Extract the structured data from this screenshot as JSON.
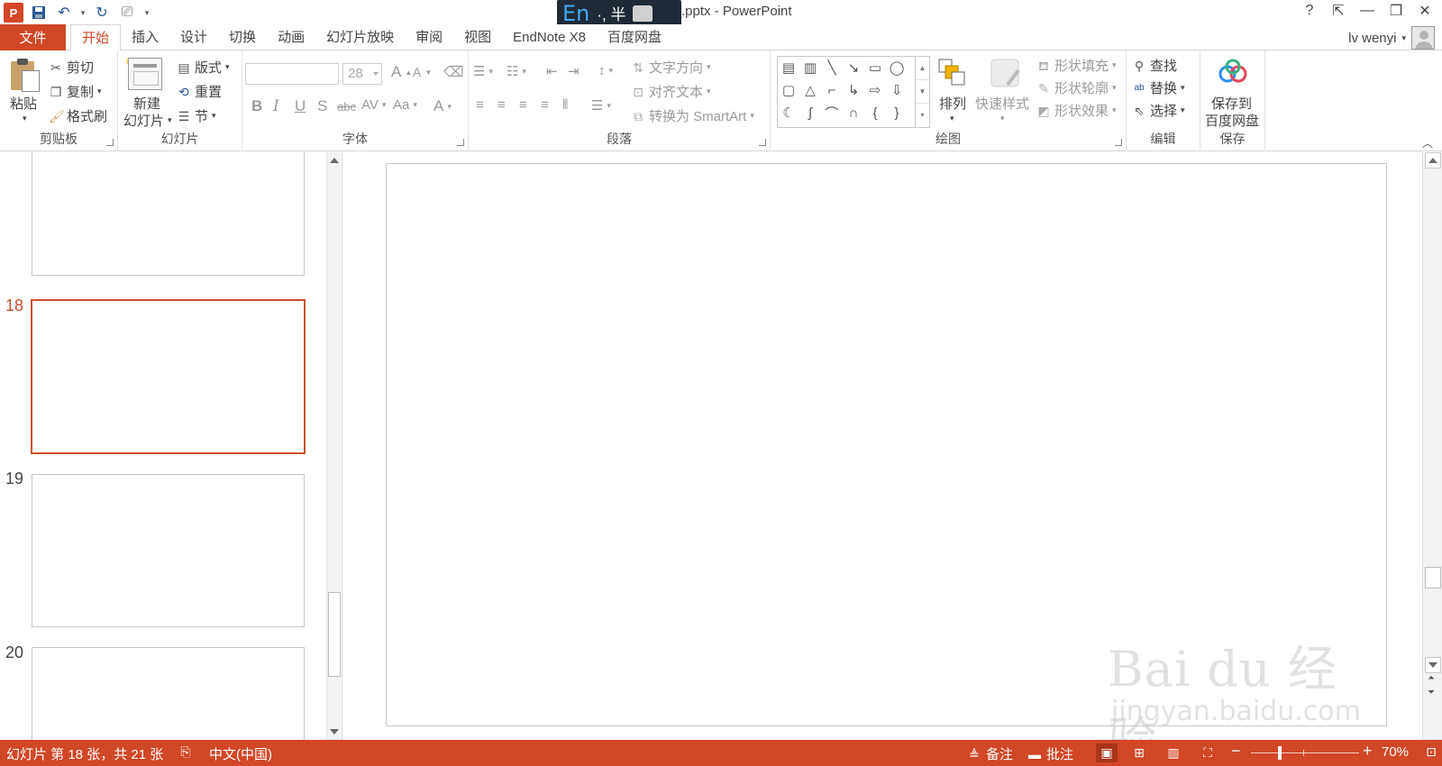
{
  "window": {
    "title": ".pptx - PowerPoint",
    "ime": {
      "lang": "En",
      "punct": "·, 半"
    },
    "controls": [
      "?",
      "⇱",
      "—",
      "❐",
      "✕"
    ]
  },
  "qat": {
    "app_icon": "P",
    "icons": [
      "save-icon",
      "undo-icon",
      "redo-icon",
      "present-from-start-icon",
      "customize-qat-icon"
    ]
  },
  "tabs": {
    "file": "文件",
    "items": [
      "开始",
      "插入",
      "设计",
      "切换",
      "动画",
      "幻灯片放映",
      "审阅",
      "视图",
      "EndNote X8",
      "百度网盘"
    ],
    "active_index": 0
  },
  "user": {
    "name": "lv wenyi"
  },
  "ribbon": {
    "clipboard": {
      "label": "剪贴板",
      "paste": "粘贴",
      "cut": "剪切",
      "copy": "复制",
      "format_painter": "格式刷"
    },
    "slides": {
      "label": "幻灯片",
      "new_slide_1": "新建",
      "new_slide_2": "幻灯片",
      "layout": "版式",
      "reset": "重置",
      "section": "节"
    },
    "font": {
      "label": "字体",
      "font_name": "",
      "font_size": "28"
    },
    "paragraph": {
      "label": "段落",
      "text_direction": "文字方向",
      "align_text": "对齐文本",
      "smartart": "转换为 SmartArt"
    },
    "drawing": {
      "label": "绘图",
      "arrange": "排列",
      "quick_styles": "快速样式",
      "shape_fill": "形状填充",
      "shape_outline": "形状轮廓",
      "shape_effects": "形状效果"
    },
    "editing": {
      "label": "编辑",
      "find": "查找",
      "replace": "替换",
      "select": "选择"
    },
    "save": {
      "label": "保存",
      "save_to_1": "保存到",
      "save_to_2": "百度网盘"
    }
  },
  "thumbnails": [
    {
      "number": "",
      "selected": false
    },
    {
      "number": "18",
      "selected": true
    },
    {
      "number": "19",
      "selected": false
    },
    {
      "number": "20",
      "selected": false
    }
  ],
  "status": {
    "slide_info": "幻灯片 第 18 张，共 21 张",
    "language": "中文(中国)",
    "notes": "备注",
    "comments": "批注",
    "zoom": "70%"
  },
  "watermark": {
    "main": "Bai du 经验",
    "sub": "jingyan.baidu.com"
  },
  "colors": {
    "accent": "#d24726",
    "selected_thumb": "#c8512e"
  }
}
